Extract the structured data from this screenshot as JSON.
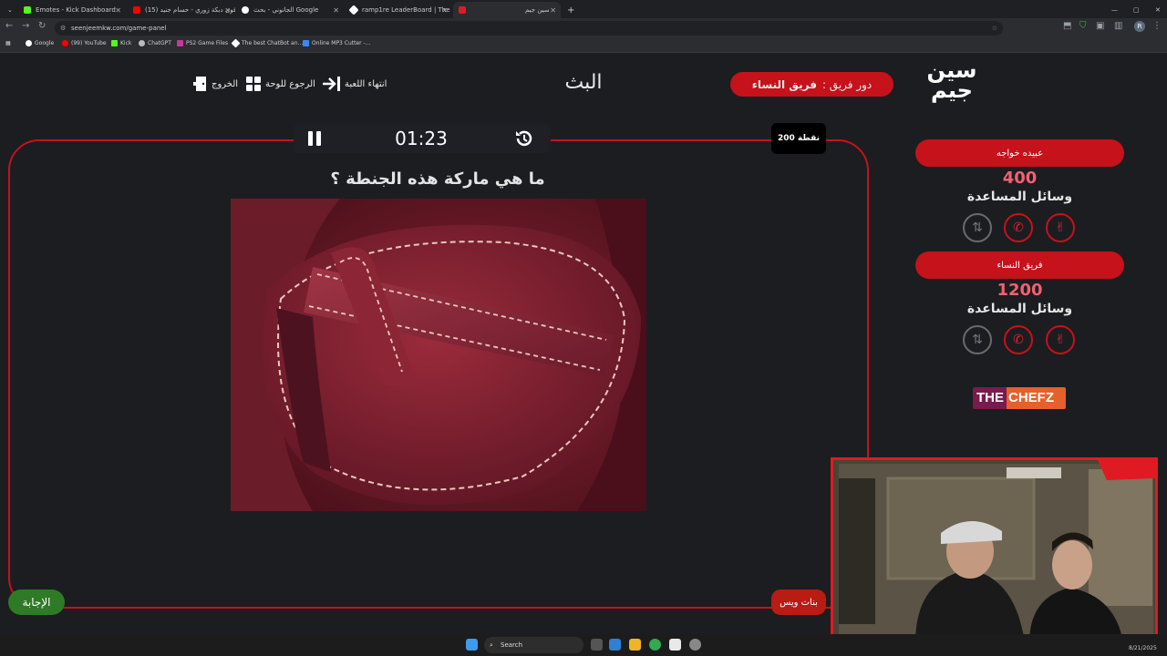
{
  "browser": {
    "tabs": [
      {
        "title": "Emotes - Kick Dashboard",
        "favicon_color": "#53fc18"
      },
      {
        "title": "(15) أقوى دبكة زوري - حسام جنيد",
        "favicon_color": "#ff0000"
      },
      {
        "title": "الجانوني - بحث Google",
        "favicon_color": "#ffffff"
      },
      {
        "title": "ramp1re LeaderBoard | The be",
        "favicon_color": "#ffffff"
      },
      {
        "title": "سين جيم",
        "favicon_color": "#e01a22"
      }
    ],
    "url": "seenjeemkw.com/game-panel",
    "bookmarks": [
      {
        "label": "Google",
        "color": "#ffffff"
      },
      {
        "label": "(99) YouTube",
        "color": "#ff0000"
      },
      {
        "label": "Kick",
        "color": "#53fc18"
      },
      {
        "label": "ChatGPT",
        "color": "#bbbbbb"
      },
      {
        "label": "PS2 Game Files",
        "color": "#c33a9a"
      },
      {
        "label": "The best ChatBot an...",
        "color": "#ffffff"
      },
      {
        "label": "Online MP3 Cutter -...",
        "color": "#3a86ff"
      }
    ]
  },
  "header": {
    "logo_line1": "سين",
    "logo_line2": "جيم",
    "turn_label": "دور فريق :",
    "turn_team": "فريق النساء",
    "broadcast": "البث",
    "end_game": "انتهاء اللعبة",
    "back_to_board": "الرجوع للوحة",
    "exit": "الخروج"
  },
  "question": {
    "timer": "01:23",
    "points": "200 نقطة",
    "text": "ما هي ماركة هذه الجنطة ؟",
    "image_icon": "leather-bag-photo",
    "team_button": "بنات ويس",
    "answer_button": "الإجابة"
  },
  "teams": [
    {
      "name": "عبيده خواجه",
      "score": "400",
      "helpers_label": "وسائل المساعدة"
    },
    {
      "name": "فريق النساء",
      "score": "1200",
      "helpers_label": "وسائل المساعدة"
    }
  ],
  "sponsor": {
    "part1": "THE",
    "part2": "CHEFZ"
  },
  "taskbar": {
    "search_placeholder": "Search",
    "date": "8/21/2025"
  },
  "colors": {
    "accent": "#c5121b",
    "score": "#f26171",
    "answer": "#2f7a26",
    "background": "#1b1d20"
  }
}
